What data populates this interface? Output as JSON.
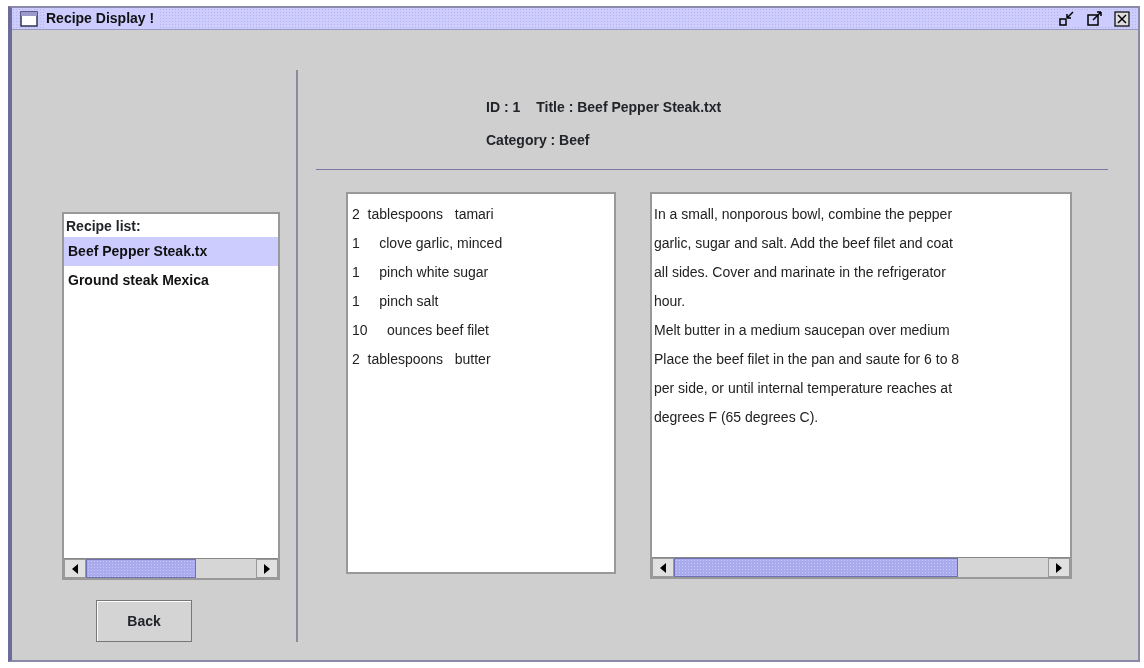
{
  "window": {
    "title": "Recipe Display !"
  },
  "recipe_list": {
    "label": "Recipe list:",
    "items": [
      {
        "label": "Beef Pepper Steak.tx",
        "selected": true
      },
      {
        "label": "Ground steak Mexica",
        "selected": false
      }
    ]
  },
  "back_button": "Back",
  "header": {
    "id": "ID : 1",
    "title": "Title : Beef Pepper Steak.txt",
    "category": "Category : Beef"
  },
  "ingredients": [
    "2  tablespoons   tamari",
    "1     clove garlic, minced",
    "1     pinch white sugar",
    "1     pinch salt",
    "10     ounces beef filet",
    "2  tablespoons   butter"
  ],
  "directions": [
    "In a small, nonporous bowl, combine the pepper",
    "garlic, sugar and salt. Add the beef filet and coat",
    "all sides. Cover and marinate in the refrigerator",
    "hour.",
    "Melt butter in a medium saucepan over medium",
    "Place the beef filet in the pan and saute for 6 to 8",
    "per side, or until internal temperature reaches at",
    "degrees F (65 degrees C)."
  ]
}
